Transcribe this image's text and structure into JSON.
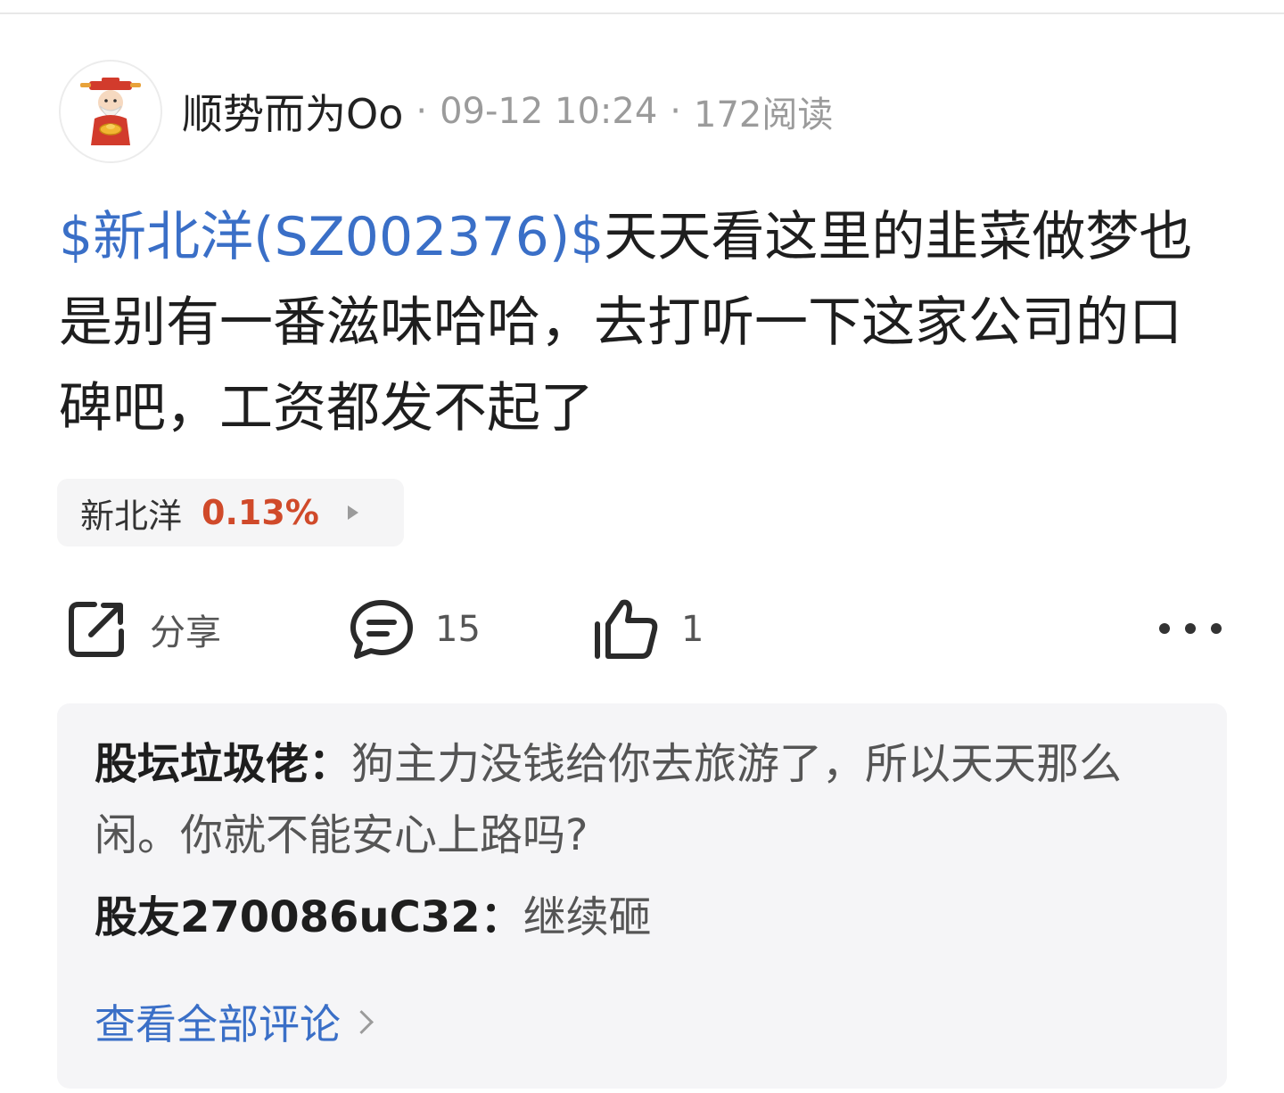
{
  "post": {
    "username": "顺势而为Oo",
    "date": "09-12 10:24",
    "reads": "172阅读",
    "meta_separator": "·",
    "stock_link": "$新北洋(SZ002376)$",
    "content": "天天看这里的韭菜做梦也是别有一番滋味哈哈，去打听一下这家公司的口碑吧，工资都发不起了"
  },
  "stock_chip": {
    "name": "新北洋",
    "change": "0.13%",
    "change_color": "#d04a2a"
  },
  "actions": {
    "share_label": "分享",
    "comment_count": "15",
    "like_count": "1"
  },
  "comments": [
    {
      "author": "股坛垃圾佬：",
      "text": "狗主力没钱给你去旅游了，所以天天那么闲。你就不能安心上路吗?"
    },
    {
      "author": "股友270086uC32：",
      "text": "继续砸"
    }
  ],
  "view_all_label": "查看全部评论",
  "colors": {
    "link_blue": "#3a6fc7",
    "muted_gray": "#9b9b9b",
    "comment_bg": "#f5f5f7"
  },
  "icons": {
    "avatar": "fortune-god-avatar",
    "share": "share-icon",
    "comment": "comment-icon",
    "like": "thumbs-up-icon",
    "more": "more-icon"
  }
}
